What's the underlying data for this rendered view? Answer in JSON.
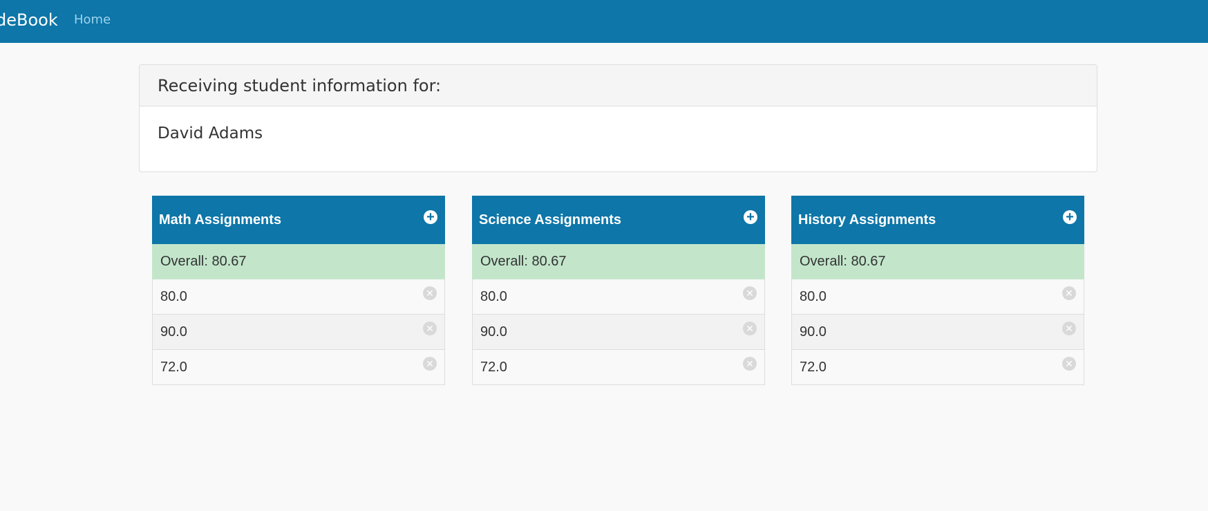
{
  "navbar": {
    "brand": "deBook",
    "home_link": "Home"
  },
  "student_panel": {
    "heading": "Receiving student information for:",
    "student_name": "David Adams"
  },
  "icons": {
    "add": "plus-circle-icon",
    "remove": "x-circle-icon"
  },
  "colors": {
    "primary": "#0e76a8",
    "overall_bg": "#c3e6cb",
    "page_bg": "#f9f9f9"
  },
  "subjects": [
    {
      "title": "Math Assignments",
      "overall": "Overall: 80.67",
      "grades": [
        "80.0",
        "90.0",
        "72.0"
      ]
    },
    {
      "title": "Science Assignments",
      "overall": "Overall: 80.67",
      "grades": [
        "80.0",
        "90.0",
        "72.0"
      ]
    },
    {
      "title": "History Assignments",
      "overall": "Overall: 80.67",
      "grades": [
        "80.0",
        "90.0",
        "72.0"
      ]
    }
  ]
}
